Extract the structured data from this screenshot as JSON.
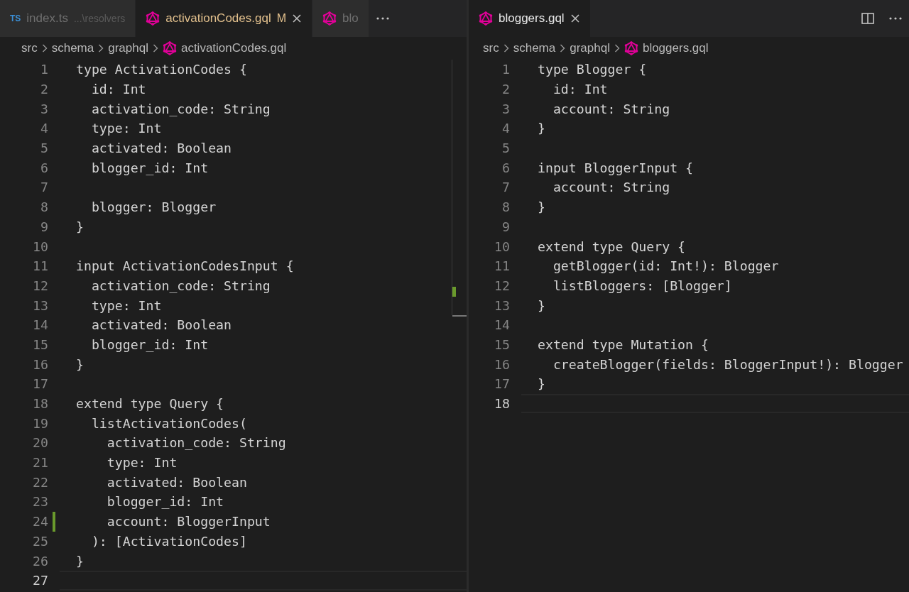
{
  "panes": [
    {
      "tabs": [
        {
          "kind": "ts",
          "badge": "TS",
          "label": "index.ts",
          "description": "...\\resolvers",
          "selected": false,
          "modified": false
        },
        {
          "kind": "gql",
          "label": "activationCodes.gql",
          "selected": true,
          "modified": true,
          "status": "M"
        },
        {
          "kind": "gql",
          "label": "blo",
          "selected": false,
          "modified": false
        }
      ],
      "actions": [
        {
          "kind": "more"
        }
      ],
      "breadcrumbs": [
        "src",
        "schema",
        "graphql",
        "activationCodes.gql"
      ],
      "scrollbar": true,
      "lines": [
        {
          "number": "1",
          "text": "type ActivationCodes {"
        },
        {
          "number": "2",
          "text": "  id: Int"
        },
        {
          "number": "3",
          "text": "  activation_code: String"
        },
        {
          "number": "4",
          "text": "  type: Int"
        },
        {
          "number": "5",
          "text": "  activated: Boolean"
        },
        {
          "number": "6",
          "text": "  blogger_id: Int"
        },
        {
          "number": "7"
        },
        {
          "number": "8",
          "text": "  blogger: Blogger"
        },
        {
          "number": "9",
          "text": "}"
        },
        {
          "number": "10"
        },
        {
          "number": "11",
          "text": "input ActivationCodesInput {"
        },
        {
          "number": "12",
          "text": "  activation_code: String"
        },
        {
          "number": "13",
          "text": "  type: Int"
        },
        {
          "number": "14",
          "text": "  activated: Boolean"
        },
        {
          "number": "15",
          "text": "  blogger_id: Int"
        },
        {
          "number": "16",
          "text": "}"
        },
        {
          "number": "17"
        },
        {
          "number": "18",
          "text": "extend type Query {"
        },
        {
          "number": "19",
          "text": "  listActivationCodes("
        },
        {
          "number": "20",
          "text": "    activation_code: String"
        },
        {
          "number": "21",
          "text": "    type: Int"
        },
        {
          "number": "22",
          "text": "    activated: Boolean"
        },
        {
          "number": "23",
          "text": "    blogger_id: Int"
        },
        {
          "number": "24",
          "text": "    account: BloggerInput",
          "modified": true
        },
        {
          "number": "25",
          "text": "  ): [ActivationCodes]"
        },
        {
          "number": "26",
          "text": "}"
        },
        {
          "number": "27",
          "current": true
        }
      ]
    },
    {
      "tabs": [
        {
          "kind": "gql",
          "label": "bloggers.gql",
          "selected": true,
          "modified": false
        }
      ],
      "actions": [
        {
          "kind": "split"
        },
        {
          "kind": "more"
        }
      ],
      "breadcrumbs": [
        "src",
        "schema",
        "graphql",
        "bloggers.gql"
      ],
      "scrollbar": false,
      "lines": [
        {
          "number": "1",
          "text": "type Blogger {"
        },
        {
          "number": "2",
          "text": "  id: Int"
        },
        {
          "number": "3",
          "text": "  account: String"
        },
        {
          "number": "4",
          "text": "}"
        },
        {
          "number": "5"
        },
        {
          "number": "6",
          "text": "input BloggerInput {"
        },
        {
          "number": "7",
          "text": "  account: String"
        },
        {
          "number": "8",
          "text": "}"
        },
        {
          "number": "9"
        },
        {
          "number": "10",
          "text": "extend type Query {"
        },
        {
          "number": "11",
          "text": "  getBlogger(id: Int!): Blogger"
        },
        {
          "number": "12",
          "text": "  listBloggers: [Blogger]"
        },
        {
          "number": "13",
          "text": "}"
        },
        {
          "number": "14"
        },
        {
          "number": "15",
          "text": "extend type Mutation {"
        },
        {
          "number": "16",
          "text": "  createBlogger(fields: BloggerInput!): Blogger"
        },
        {
          "number": "17",
          "text": "}"
        },
        {
          "number": "18",
          "current": true
        }
      ]
    }
  ]
}
